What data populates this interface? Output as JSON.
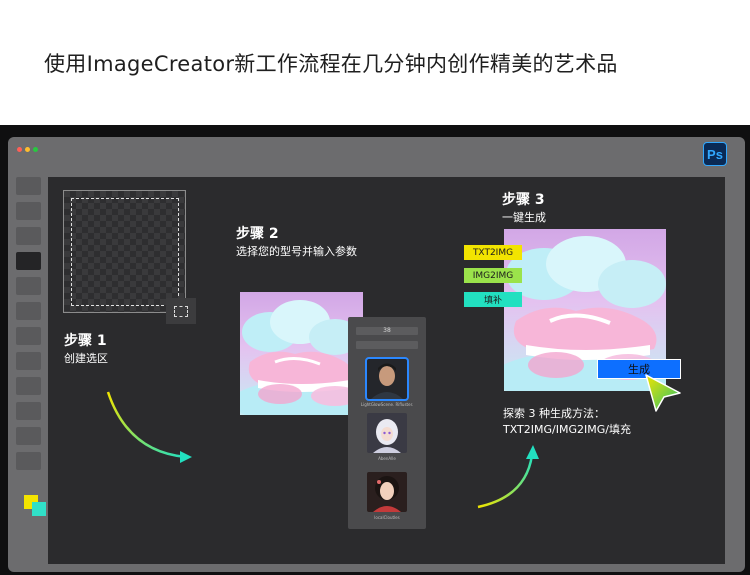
{
  "headline": "使用ImageCreator新工作流程在几分钟内创作精美的艺术品",
  "app": {
    "badge": "Ps"
  },
  "toolbar": {
    "tool_count": 12,
    "active_tool_index": 3
  },
  "step1": {
    "title": "步骤 1",
    "desc": "创建选区"
  },
  "step2": {
    "title": "步骤 2",
    "desc": "选择您的型号并输入参数"
  },
  "step3": {
    "title": "步骤 3",
    "desc": "一键生成"
  },
  "panel": {
    "header": "38",
    "models": [
      {
        "name": "realistic-male-portrait",
        "caption": "LightGlowScene. Rifluster."
      },
      {
        "name": "anime-girl-portrait",
        "caption": "AbenAlle"
      },
      {
        "name": "asian-female-portrait",
        "caption": "localCloutles"
      }
    ]
  },
  "modes": [
    "TXT2IMG",
    "IMG2IMG",
    "填补"
  ],
  "mode_colors": [
    "#f2e400",
    "#9be34b",
    "#22e0c0"
  ],
  "generate_label": "生成",
  "explore": {
    "line1": "探索 3 种生成方法：",
    "line2": "TXT2IMG/IMG2IMG/填充"
  }
}
